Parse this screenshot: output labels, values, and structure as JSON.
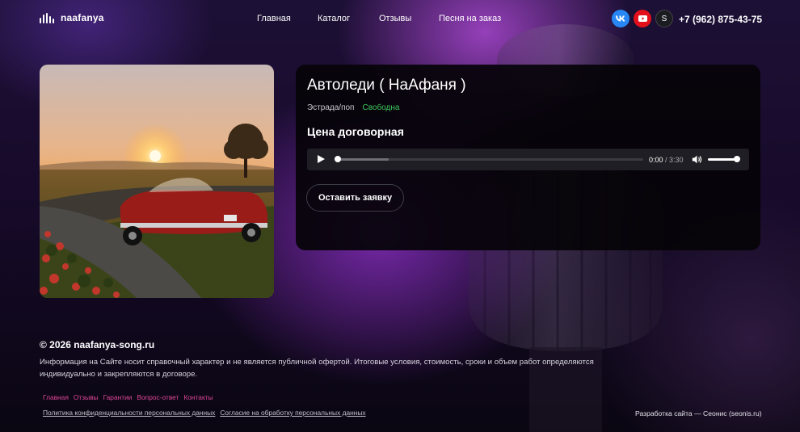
{
  "header": {
    "logo_text": "naafanya",
    "nav": [
      {
        "label": "Главная"
      },
      {
        "label": "Каталог"
      },
      {
        "label": "Отзывы"
      },
      {
        "label": "Песня на заказ"
      }
    ],
    "socials": [
      {
        "icon": "vk-icon",
        "label": "VK"
      },
      {
        "icon": "youtube-icon",
        "label": ""
      },
      {
        "icon": "s-icon",
        "label": "S"
      }
    ],
    "phone": "+7 (962) 875-43-75"
  },
  "song": {
    "title": "Автоледи ( НаАфаня )",
    "genre": "Эстрада/поп",
    "status": "Свободна",
    "price": "Цена договорная",
    "player": {
      "current_time": "0:00",
      "separator": " / ",
      "duration": "3:30",
      "progress_fraction": 0.0,
      "buffered_fraction": 0.17,
      "volume_fraction": 1.0
    },
    "cta_label": "Оставить заявку"
  },
  "footer": {
    "copyright": "© 2026 naafanya-song.ru",
    "disclaimer": "Информация на Сайте носит справочный характер и не является публичной офертой. Итоговые условия, стоимость, сроки и объем работ определяются индивидуально и закрепляются в договоре.",
    "links": [
      {
        "label": "Главная"
      },
      {
        "label": "Отзывы"
      },
      {
        "label": "Гарантии"
      },
      {
        "label": "Вопрос-ответ"
      },
      {
        "label": "Контакты"
      }
    ],
    "policy_links": [
      {
        "label": "Политика конфиденциальности персональных данных"
      },
      {
        "label": "Согласие на обработку персональных данных"
      }
    ],
    "developer": "Разработка сайта — Сеонис (seonis.ru)"
  },
  "colors": {
    "accent_pink": "#e0479a",
    "status_green": "#3ec75b",
    "vk_blue": "#2787f5",
    "youtube_red": "#e3101b"
  }
}
